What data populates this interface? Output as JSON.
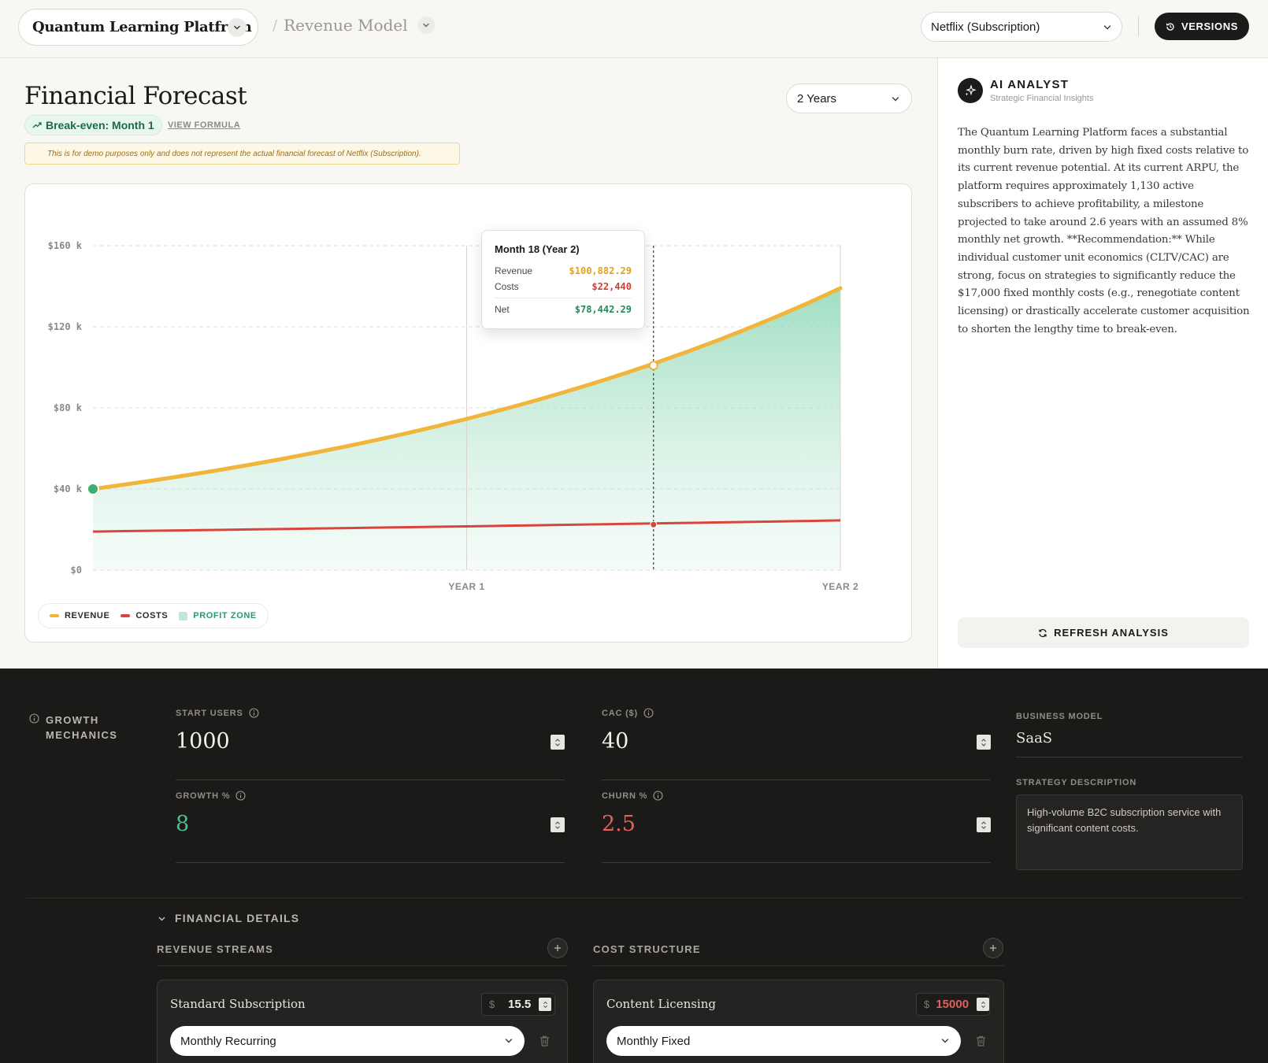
{
  "header": {
    "project_name": "Quantum Learning Platfrom",
    "crumb_separator": "/",
    "crumb_label": "Revenue Model",
    "model_select": "Netflix (Subscription)",
    "versions_label": "VERSIONS"
  },
  "forecast": {
    "title": "Financial Forecast",
    "period": "2 Years",
    "break_even": "Break-even: Month 1",
    "view_formula": "VIEW FORMULA",
    "disclaimer": "This is for demo purposes only and does not represent the actual financial forecast of Netflix (Subscription)."
  },
  "chart_data": {
    "type": "area",
    "x_labels": [
      "YEAR 1",
      "YEAR 2"
    ],
    "y_ticks": [
      "$160 k",
      "$120 k",
      "$80 k",
      "$40 k",
      "$0"
    ],
    "ylim": [
      0,
      160000
    ],
    "months": 24,
    "series": [
      {
        "name": "REVENUE",
        "color": "#f0b53a",
        "start": 40000,
        "month18": 100882.29,
        "end": 139000
      },
      {
        "name": "COSTS",
        "color": "#d8453c",
        "start": 19000,
        "month18": 22440,
        "end": 24500
      }
    ],
    "profit_zone_label": "PROFIT ZONE",
    "grid": true,
    "legend_position": "bottom-left"
  },
  "tooltip": {
    "title": "Month 18 (Year 2)",
    "month": 18,
    "revenue_label": "Revenue",
    "revenue_value": "$100,882.29",
    "costs_label": "Costs",
    "costs_value": "$22,440",
    "net_label": "Net",
    "net_value": "$78,442.29"
  },
  "analyst": {
    "title": "AI ANALYST",
    "subtitle": "Strategic Financial Insights",
    "body": "The Quantum Learning Platform faces a substantial monthly burn rate, driven by high fixed costs relative to its current revenue potential. At its current ARPU, the platform requires approximately 1,130 active subscribers to achieve profitability, a milestone projected to take around 2.6 years with an assumed 8% monthly net growth. **Recommendation:** While individual customer unit economics (CLTV/CAC) are strong, focus on strategies to significantly reduce the $17,000 fixed monthly costs (e.g., renegotiate content licensing) or drastically accelerate customer acquisition to shorten the lengthy time to break-even.",
    "refresh_label": "REFRESH ANALYSIS"
  },
  "growth": {
    "section_label": "GROWTH MECHANICS",
    "start_users_label": "START USERS",
    "start_users": "1000",
    "cac_label": "CAC ($)",
    "cac": "40",
    "growth_label": "GROWTH %",
    "growth": "8",
    "churn_label": "CHURN %",
    "churn": "2.5",
    "growth_color": "#4cbf8a",
    "churn_color": "#e0625a"
  },
  "business": {
    "model_label": "BUSINESS MODEL",
    "model": "SaaS",
    "strategy_label": "STRATEGY DESCRIPTION",
    "strategy": "High-volume B2C subscription service with significant content costs."
  },
  "financial": {
    "section_label": "FINANCIAL DETAILS",
    "revenue_title": "REVENUE STREAMS",
    "cost_title": "COST STRUCTURE",
    "revenue_item": {
      "name": "Standard Subscription",
      "currency": "$",
      "price": "15.5",
      "type": "Monthly Recurring"
    },
    "cost_item": {
      "name": "Content Licensing",
      "currency": "$",
      "price": "15000",
      "type": "Monthly Fixed"
    }
  }
}
